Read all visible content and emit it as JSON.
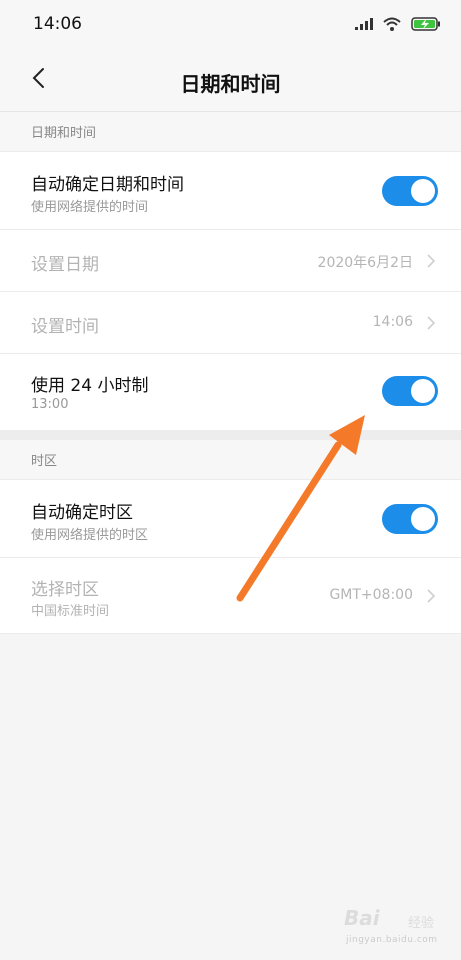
{
  "status_bar": {
    "time": "14:06",
    "icons": [
      "signal-icon",
      "wifi-icon",
      "battery-charging-icon"
    ]
  },
  "header": {
    "back_icon": "back-chevron-icon",
    "title": "日期和时间"
  },
  "sections": {
    "datetime": {
      "header": "日期和时间",
      "auto_datetime": {
        "title": "自动确定日期和时间",
        "subtitle": "使用网络提供的时间",
        "enabled": true
      },
      "set_date": {
        "title": "设置日期",
        "value": "2020年6月2日"
      },
      "set_time": {
        "title": "设置时间",
        "value": "14:06"
      },
      "use_24h": {
        "title": "使用 24 小时制",
        "subtitle": "13:00",
        "enabled": true
      }
    },
    "timezone": {
      "header": "时区",
      "auto_timezone": {
        "title": "自动确定时区",
        "subtitle": "使用网络提供的时区",
        "enabled": true
      },
      "select_timezone": {
        "title": "选择时区",
        "subtitle": "中国标准时间",
        "value": "GMT+08:00"
      }
    }
  },
  "watermark": {
    "logo": "Bai",
    "label": "经验",
    "url": "jingyan.baidu.com"
  },
  "colors": {
    "accent": "#1c8de9",
    "annotation_arrow": "#f47a2a",
    "background": "#f5f5f5"
  }
}
